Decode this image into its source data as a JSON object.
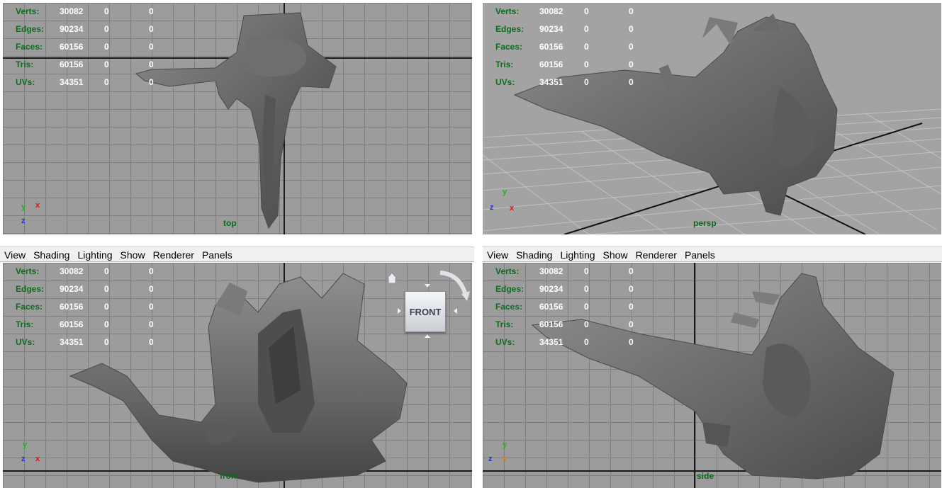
{
  "menu": [
    "View",
    "Shading",
    "Lighting",
    "Show",
    "Renderer",
    "Panels"
  ],
  "hud": {
    "rows": [
      {
        "label": "Verts:",
        "v1": "30082",
        "v2": "0",
        "v3": "0"
      },
      {
        "label": "Edges:",
        "v1": "90234",
        "v2": "0",
        "v3": "0"
      },
      {
        "label": "Faces:",
        "v1": "60156",
        "v2": "0",
        "v3": "0"
      },
      {
        "label": "Tris:",
        "v1": "60156",
        "v2": "0",
        "v3": "0"
      },
      {
        "label": "UVs:",
        "v1": "34351",
        "v2": "0",
        "v3": "0"
      }
    ]
  },
  "viewports": {
    "top": {
      "camera": "top"
    },
    "persp": {
      "camera": "persp"
    },
    "front": {
      "camera": "front"
    },
    "side": {
      "camera": "side"
    }
  },
  "axes": {
    "x": "x",
    "y": "y",
    "z": "z"
  },
  "viewcube": {
    "face_label": "FRONT"
  },
  "icons": [
    "home-icon",
    "rotate-arrow-icon",
    "view-arrow-icon"
  ],
  "colors": {
    "hud_label": "#0d6b1e",
    "hud_value": "#ffffff",
    "axis_x": "#e01010",
    "axis_y": "#15b815",
    "axis_z": "#2233dd",
    "viewport_bg": "#9c9c9c",
    "grid": "#7f7f7f",
    "mesh": "#6b6b6b"
  }
}
